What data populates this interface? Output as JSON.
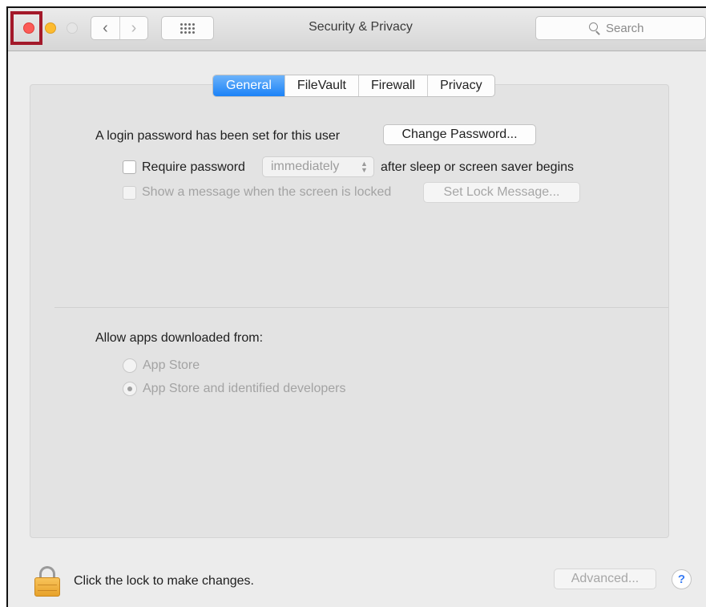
{
  "window": {
    "title": "Security & Privacy",
    "nav_back": "‹",
    "nav_forward": "›",
    "search_placeholder": "Search"
  },
  "tabs": [
    {
      "label": "General",
      "active": true
    },
    {
      "label": "FileVault",
      "active": false
    },
    {
      "label": "Firewall",
      "active": false
    },
    {
      "label": "Privacy",
      "active": false
    }
  ],
  "general": {
    "login_password_text": "A login password has been set for this user",
    "change_password_label": "Change Password...",
    "require_password_label": "Require password",
    "require_password_checked": false,
    "require_password_interval": "immediately",
    "require_password_suffix": "after sleep or screen saver begins",
    "show_message_label": "Show a message when the screen is locked",
    "show_message_checked": false,
    "set_lock_message_label": "Set Lock Message..."
  },
  "allow_apps": {
    "label": "Allow apps downloaded from:",
    "options": [
      {
        "label": "App Store",
        "selected": false
      },
      {
        "label": "App Store and identified developers",
        "selected": true
      }
    ]
  },
  "footer": {
    "lock_text": "Click the lock to make changes.",
    "advanced_label": "Advanced...",
    "help_label": "?"
  },
  "colors": {
    "close": "#fc5b57",
    "minimize": "#fdbb2f",
    "tab_active": "#1b82f7",
    "highlight_box": "#a3192a"
  }
}
